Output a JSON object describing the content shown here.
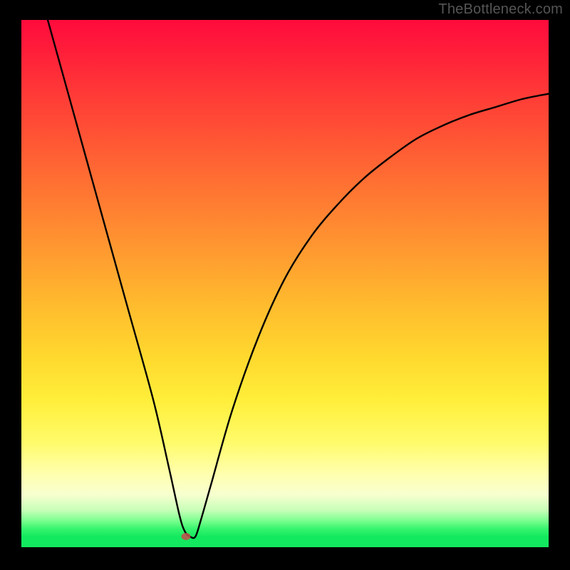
{
  "watermark": "TheBottleneck.com",
  "colors": {
    "background": "#000000",
    "curve": "#000000",
    "marker": "#c44b4b"
  },
  "chart_data": {
    "type": "line",
    "title": "",
    "xlabel": "",
    "ylabel": "",
    "xlim": [
      0,
      100
    ],
    "ylim": [
      0,
      100
    ],
    "grid": false,
    "series": [
      {
        "name": "bottleneck-curve",
        "x": [
          5,
          10,
          15,
          20,
          25,
          28,
          30,
          31,
          32,
          33,
          34,
          36,
          40,
          45,
          50,
          55,
          60,
          65,
          70,
          75,
          80,
          85,
          90,
          95,
          100
        ],
        "y": [
          100,
          82,
          64,
          46,
          28,
          15,
          6,
          3,
          2,
          2,
          5,
          12,
          26,
          40,
          51,
          59,
          65,
          70,
          74,
          77.5,
          80,
          82,
          83.5,
          85,
          86
        ]
      }
    ],
    "annotations": [
      {
        "name": "optimal-marker",
        "x": 31.2,
        "y": 2
      }
    ],
    "gradient_description": "vertical heat gradient: red (top, high bottleneck) through orange/yellow to green (bottom, low bottleneck)"
  }
}
